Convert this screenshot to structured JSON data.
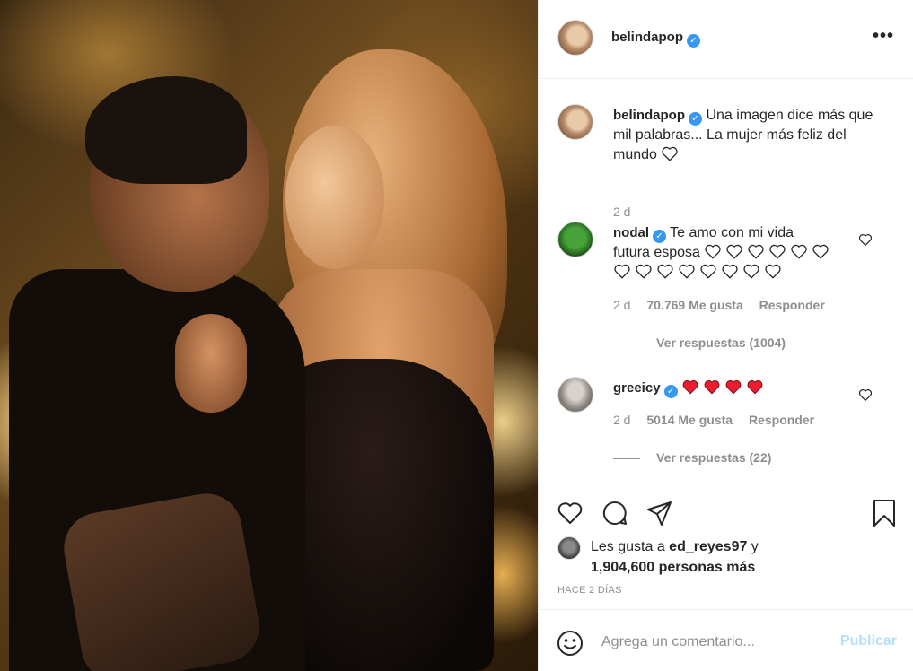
{
  "post": {
    "username": "belindapop",
    "caption_user": "belindapop",
    "caption": "Una imagen dice más que mil palabras... La mujer más feliz del mundo",
    "caption_time": "2 d"
  },
  "comments": [
    {
      "username": "nodal",
      "text_line1": "Te amo con mi vida",
      "text_line2": "futura esposa",
      "hearts_line2": 6,
      "hearts_line3": 8,
      "time": "2 d",
      "likes": "70.769 Me gusta",
      "reply": "Responder",
      "view_replies": "Ver respuestas (1004)"
    },
    {
      "username": "greeicy",
      "red_hearts": 4,
      "time": "2 d",
      "likes": "5014 Me gusta",
      "reply": "Responder",
      "view_replies": "Ver respuestas (22)"
    }
  ],
  "likes": {
    "prefix": "Les gusta a ",
    "user": "ed_reyes97",
    "joiner": " y",
    "count": "1,904,600 personas más"
  },
  "timeago": "HACE 2 DÍAS",
  "add_comment": {
    "placeholder": "Agrega un comentario...",
    "publish": "Publicar"
  },
  "icons": {
    "more": "more-options-icon",
    "like": "heart-icon",
    "comment": "comment-icon",
    "share": "share-icon",
    "save": "bookmark-icon",
    "emoji": "emoji-icon",
    "verified": "verified-badge-icon"
  },
  "colors": {
    "accent_blue": "#3897f0",
    "publish_disabled": "#b2dffc",
    "muted": "#8e8e8e",
    "heart_red": "#ed1c2e"
  }
}
